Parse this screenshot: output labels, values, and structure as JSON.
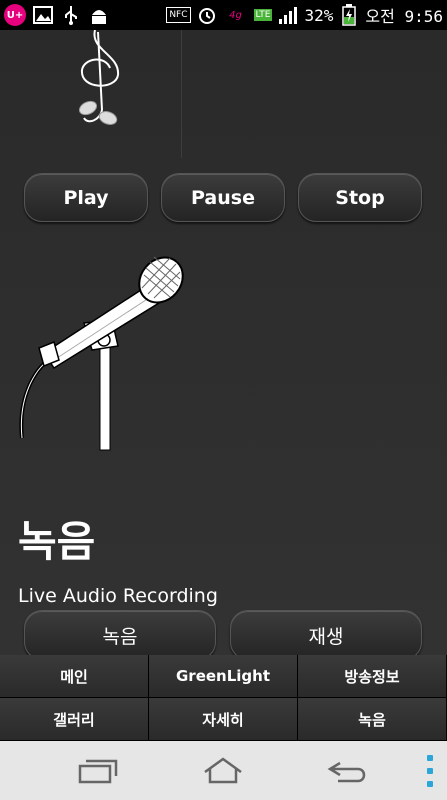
{
  "status_bar": {
    "carrier_badge": "U+",
    "nfc_label": "NFC",
    "lte_label": "LTE",
    "battery_percent": "32%",
    "time": "오전 9:56"
  },
  "player": {
    "play_label": "Play",
    "pause_label": "Pause",
    "stop_label": "Stop"
  },
  "content": {
    "title": "녹음",
    "subtitle": "Live Audio Recording",
    "record_label": "녹음",
    "playback_label": "재생"
  },
  "menu": {
    "items": [
      "메인",
      "GreenLight",
      "방송정보",
      "갤러리",
      "자세히",
      "녹음"
    ]
  }
}
